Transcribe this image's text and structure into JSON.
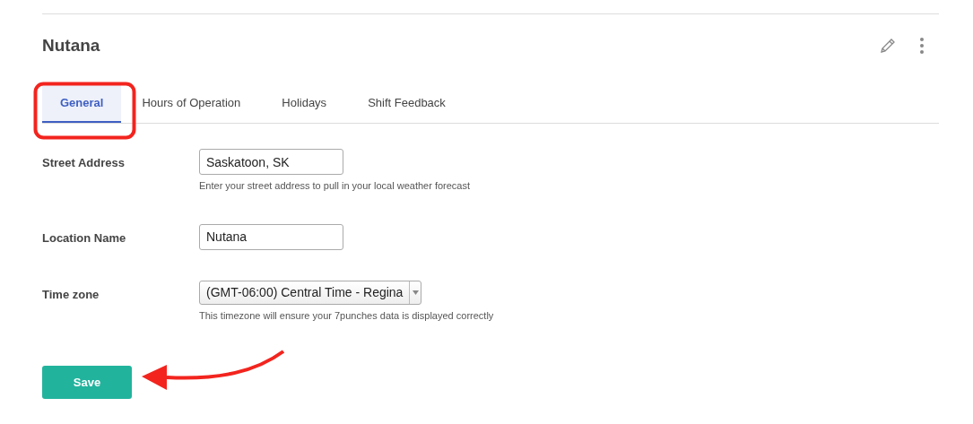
{
  "title": "Nutana",
  "tabs": [
    {
      "label": "General",
      "selected": true
    },
    {
      "label": "Hours of Operation",
      "selected": false
    },
    {
      "label": "Holidays",
      "selected": false
    },
    {
      "label": "Shift Feedback",
      "selected": false
    }
  ],
  "fields": [
    {
      "kind": "text",
      "label": "Street Address",
      "value": "Saskatoon, SK",
      "help": "Enter your street address to pull in your local weather forecast"
    },
    {
      "kind": "text",
      "label": "Location Name",
      "value": "Nutana"
    },
    {
      "kind": "select",
      "label": "Time zone",
      "value": "(GMT-06:00) Central Time - Regina",
      "help": "This timezone will ensure your 7punches data is displayed correctly"
    }
  ],
  "save_button": "Save"
}
